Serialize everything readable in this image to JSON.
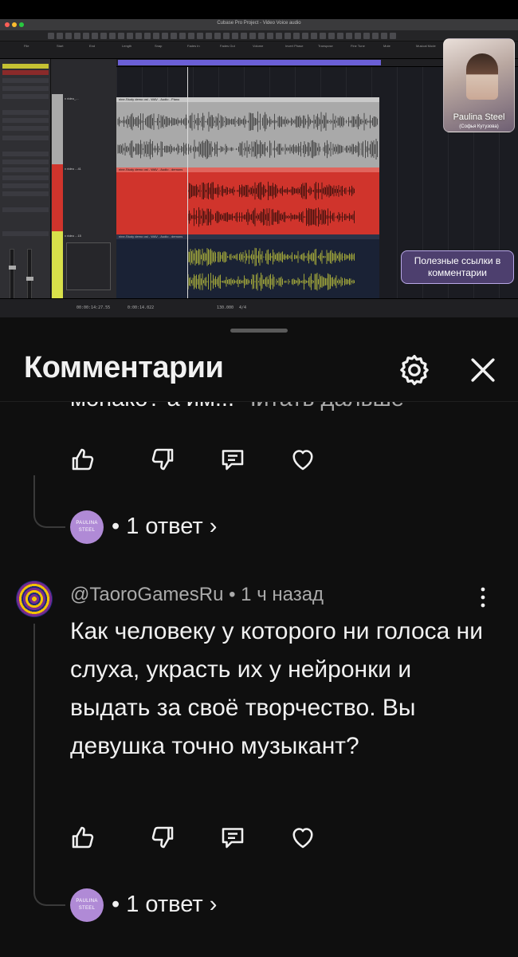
{
  "video": {
    "window_title": "Cubase Pro Project - Video Voice audio",
    "infobar_fields": [
      "File",
      "Start",
      "End",
      "Length",
      "Snap",
      "Fades In",
      "Fades Out",
      "Volume",
      "Invert Phase",
      "Transpose",
      "Fine Tune",
      "Mute",
      "Musical Mode",
      "Algorithm",
      "Extension"
    ],
    "track_names": [
      "v rideo_...",
      "v rideo ...41",
      "v rideo ...15"
    ],
    "lane_headers": [
      "nine-Study demo ost - WAV - Audio - Piano",
      "nine-Study demo ost - WAV - Audio - demons",
      "nine-Study demo ost - WAV - Audio - demons"
    ],
    "status_time_left": "00:00:14:27.55",
    "status_time_mid": "0:00:14.022",
    "status_tempo": "130.000",
    "status_sig": "4/4",
    "channel_name": "Paulina Steel",
    "channel_sub": "(Софья Кутузова)",
    "links_button": "Полезные ссылки в комментарии"
  },
  "panel": {
    "title": "Комментарии",
    "settings_icon": "gear-icon",
    "close_icon": "close-icon"
  },
  "comment1": {
    "text_clipped": "монако? а им...",
    "read_more": "Читать дальше",
    "replies": "• 1 ответ ›",
    "reply_avatar_top": "PAULINA",
    "reply_avatar_bottom": "STEEL"
  },
  "comment2": {
    "author": "@TaoroGamesRu",
    "time": "• 1 ч назад",
    "text": "Как человеку у которого ни голоса ни слуха, украсть их у нейронки и выдать за своё творчество. Вы девушка точно музыкант?",
    "replies": "• 1 ответ ›",
    "reply_avatar_top": "PAULINA",
    "reply_avatar_bottom": "STEEL"
  },
  "colors": {
    "background": "#0f0f0f",
    "text": "#f1f1f1",
    "secondary": "#aaaaaa",
    "track_red": "#d0342c",
    "track_grey": "#a9a9a9",
    "track_navy": "#1a2235",
    "loop_purple": "#6b5fd6"
  }
}
